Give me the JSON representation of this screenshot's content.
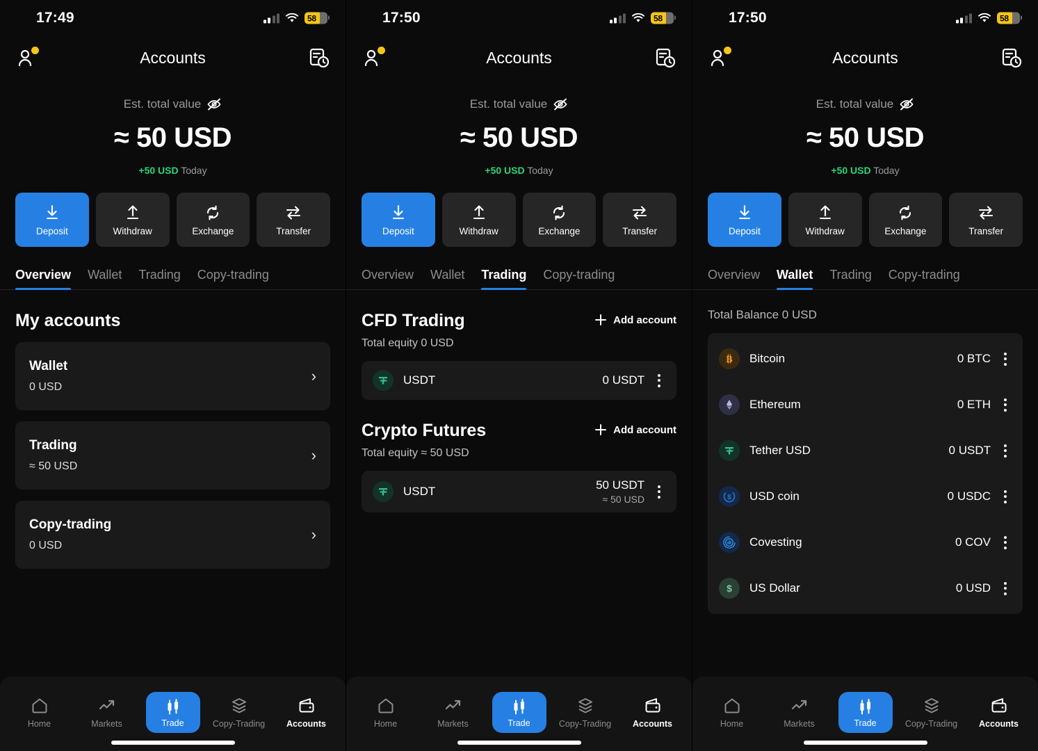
{
  "status_bar": {
    "time_left": "17:49",
    "time_mid": "17:50",
    "time_right": "17:50",
    "battery_percent": "58",
    "battery_color": "#f5c518",
    "signal_bars_on": 2,
    "signal_bars_total": 4,
    "wifi_icon": "wifi-icon"
  },
  "header": {
    "title": "Accounts",
    "profile_icon": "person-icon",
    "profile_badge": "notification-dot",
    "history_icon": "document-clock-icon"
  },
  "balance": {
    "label": "Est. total value",
    "hide_icon": "eye-off-icon",
    "amount": "≈ 50 USD",
    "change": "+50 USD",
    "change_color": "#2bd67b",
    "period": "Today"
  },
  "actions": [
    {
      "label": "Deposit",
      "icon": "download-arrow-icon",
      "active": true
    },
    {
      "label": "Withdraw",
      "icon": "upload-arrow-icon",
      "active": false
    },
    {
      "label": "Exchange",
      "icon": "refresh-circle-icon",
      "active": false
    },
    {
      "label": "Transfer",
      "icon": "transfer-arrows-icon",
      "active": false
    }
  ],
  "tabs": [
    "Overview",
    "Wallet",
    "Trading",
    "Copy-trading"
  ],
  "accent_color": "#2680e3",
  "screen1": {
    "active_tab": "Overview",
    "section_title": "My accounts",
    "accounts": [
      {
        "title": "Wallet",
        "value": "0 USD",
        "chevron": "chevron-right-icon"
      },
      {
        "title": "Trading",
        "value": "≈ 50 USD",
        "chevron": "chevron-right-icon"
      },
      {
        "title": "Copy-trading",
        "value": "0 USD",
        "chevron": "chevron-right-icon"
      }
    ]
  },
  "screen2": {
    "active_tab": "Trading",
    "groups": [
      {
        "title": "CFD Trading",
        "add_label": "Add account",
        "add_icon": "plus-icon",
        "equity": "Total equity 0 USD",
        "rows": [
          {
            "symbol": "USDT",
            "icon": "tether-icon",
            "value": "0 USDT",
            "sub": ""
          }
        ]
      },
      {
        "title": "Crypto Futures",
        "add_label": "Add account",
        "add_icon": "plus-icon",
        "equity": "Total equity ≈ 50 USD",
        "rows": [
          {
            "symbol": "USDT",
            "icon": "tether-icon",
            "value": "50 USDT",
            "sub": "≈ 50 USD"
          }
        ]
      }
    ]
  },
  "screen3": {
    "active_tab": "Wallet",
    "total_balance": "Total Balance 0 USD",
    "assets": [
      {
        "name": "Bitcoin",
        "value": "0 BTC",
        "icon": "bitcoin-icon",
        "bg": "#3b2a12",
        "fg": "#f7931a"
      },
      {
        "name": "Ethereum",
        "value": "0 ETH",
        "icon": "ethereum-icon",
        "bg": "#2f2f45",
        "fg": "#b8b8d8"
      },
      {
        "name": "Tether USD",
        "value": "0 USDT",
        "icon": "tether-icon",
        "bg": "#133329",
        "fg": "#34c08a"
      },
      {
        "name": "USD coin",
        "value": "0 USDC",
        "icon": "usdc-icon",
        "bg": "#12294a",
        "fg": "#2775ca"
      },
      {
        "name": "Covesting",
        "value": "0 COV",
        "icon": "covesting-icon",
        "bg": "#12294a",
        "fg": "#2e9bf0"
      },
      {
        "name": "US Dollar",
        "value": "0 USD",
        "icon": "dollar-icon",
        "bg": "#2a4034",
        "fg": "#7fc79c"
      }
    ],
    "row_menu_icon": "kebab-menu-icon"
  },
  "bottom_nav": {
    "items": [
      {
        "label": "Home",
        "icon": "home-icon",
        "state": "inactive"
      },
      {
        "label": "Markets",
        "icon": "trend-up-icon",
        "state": "inactive"
      },
      {
        "label": "Trade",
        "icon": "candlestick-icon",
        "state": "pill"
      },
      {
        "label": "Copy-Trading",
        "icon": "layers-icon",
        "state": "inactive"
      },
      {
        "label": "Accounts",
        "icon": "wallet-icon",
        "state": "current"
      }
    ]
  }
}
